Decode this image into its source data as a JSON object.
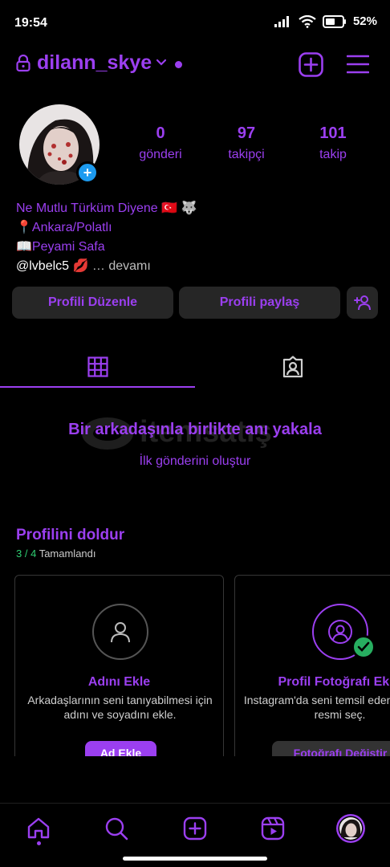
{
  "status_bar": {
    "time": "19:54",
    "battery": "52%"
  },
  "header": {
    "username": "dilann_skye"
  },
  "profile": {
    "stats": [
      {
        "value": "0",
        "label": "gönderi"
      },
      {
        "value": "97",
        "label": "takipçi"
      },
      {
        "value": "101",
        "label": "takip"
      }
    ],
    "bio_line1": "Ne Mutlu Türküm Diyene 🇹🇷 🐺",
    "bio_line2": "📍Ankara/Polatlı",
    "bio_line3": "📖Peyami Safa",
    "bio_handle": "@lvbelc5 💋",
    "bio_more": "… devamı"
  },
  "buttons": {
    "edit_profile": "Profili Düzenle",
    "share_profile": "Profili paylaş"
  },
  "empty_state": {
    "title": "Bir arkadaşınla birlikte anı yakala",
    "link": "İlk gönderini oluştur"
  },
  "complete_profile": {
    "title": "Profilini doldur",
    "progress_count": "3 / 4",
    "progress_label": "Tamamlandı",
    "cards": [
      {
        "title": "Adını Ekle",
        "description": "Arkadaşlarının seni tanıyabilmesi için adını ve soyadını ekle.",
        "button": "Ad Ekle",
        "completed": false
      },
      {
        "title": "Profil Fotoğrafı Ekle",
        "description": "Instagram'da seni temsil eden bir profil resmi seç.",
        "button": "Fotoğrafı Değiştir",
        "completed": true
      }
    ]
  },
  "watermark": {
    "text": "itemsatış"
  },
  "colors": {
    "accent": "#9b3ff0",
    "panel": "#262626",
    "check": "#27ae60",
    "badge": "#1d9bf0"
  },
  "icons": [
    "lock-icon",
    "chevron-down-icon",
    "plus-square-icon",
    "menu-icon",
    "add-person-icon",
    "grid-icon",
    "tagged-icon",
    "home-icon",
    "search-icon",
    "create-icon",
    "reels-icon",
    "profile-avatar-icon"
  ]
}
